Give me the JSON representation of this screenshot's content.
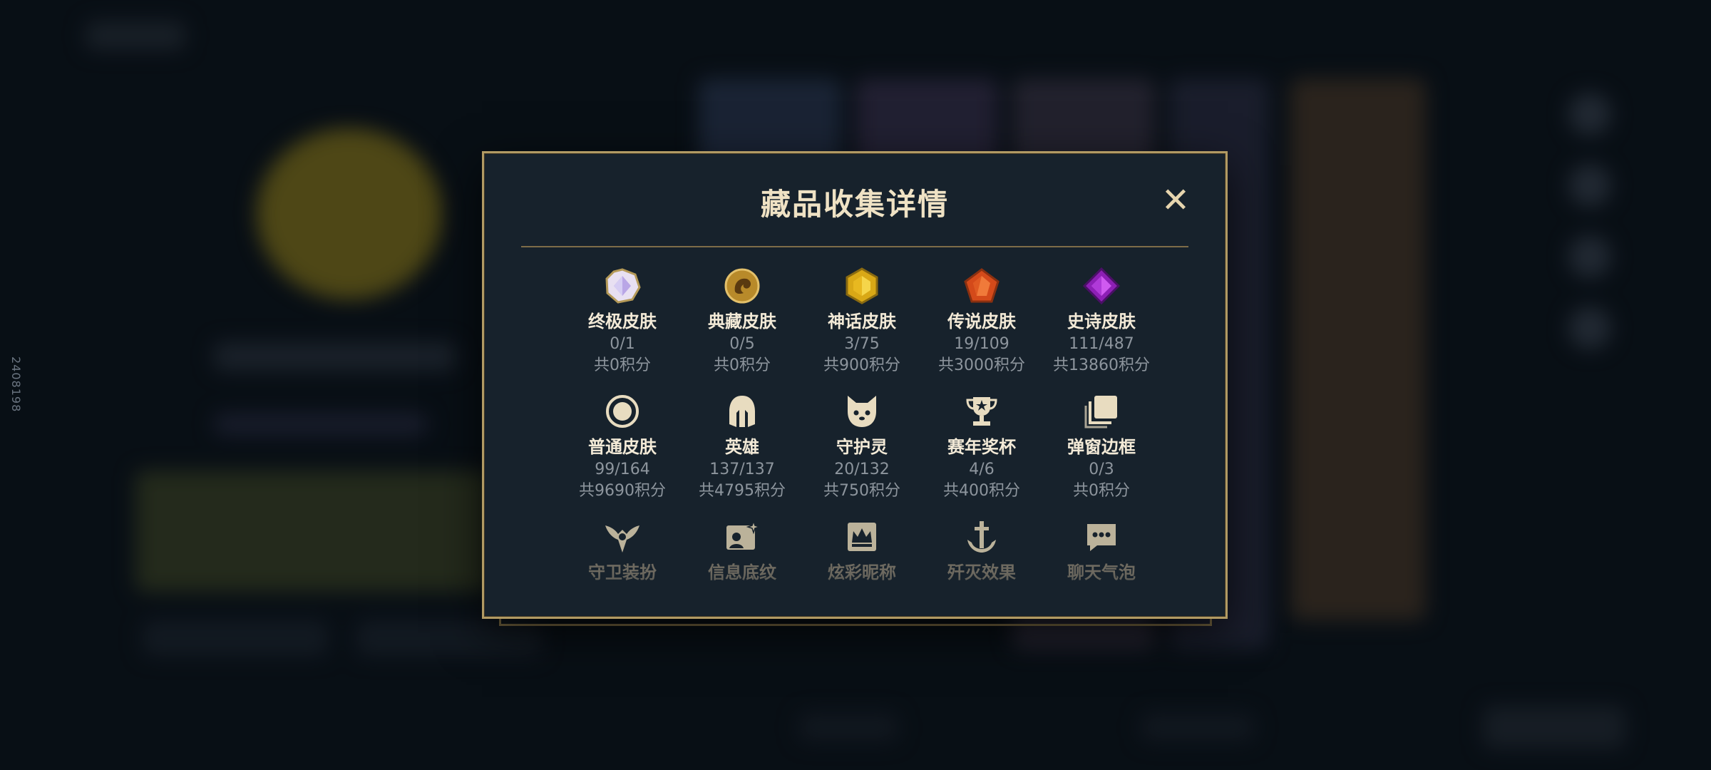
{
  "side_label": "2408198",
  "dialog": {
    "title": "藏品收集详情",
    "close_label": "✕"
  },
  "items": [
    {
      "name": "终极皮肤",
      "count": "0/1",
      "points": "共0积分",
      "icon": "ultimate-gem-icon"
    },
    {
      "name": "典藏皮肤",
      "count": "0/5",
      "points": "共0积分",
      "icon": "dragon-emblem-icon"
    },
    {
      "name": "神话皮肤",
      "count": "3/75",
      "points": "共900积分",
      "icon": "mythic-gem-icon"
    },
    {
      "name": "传说皮肤",
      "count": "19/109",
      "points": "共3000积分",
      "icon": "legendary-gem-icon"
    },
    {
      "name": "史诗皮肤",
      "count": "111/487",
      "points": "共13860积分",
      "icon": "epic-gem-icon"
    },
    {
      "name": "普通皮肤",
      "count": "99/164",
      "points": "共9690积分",
      "icon": "ring-icon"
    },
    {
      "name": "英雄",
      "count": "137/137",
      "points": "共4795积分",
      "icon": "helmet-icon"
    },
    {
      "name": "守护灵",
      "count": "20/132",
      "points": "共750积分",
      "icon": "guardian-icon"
    },
    {
      "name": "赛年奖杯",
      "count": "4/6",
      "points": "共400积分",
      "icon": "trophy-icon"
    },
    {
      "name": "弹窗边框",
      "count": "0/3",
      "points": "共0积分",
      "icon": "frame-icon"
    },
    {
      "name": "守卫装扮",
      "icon": "ward-icon"
    },
    {
      "name": "信息底纹",
      "icon": "banner-icon"
    },
    {
      "name": "炫彩昵称",
      "icon": "crown-card-icon"
    },
    {
      "name": "歼灭效果",
      "icon": "anchor-sword-icon"
    },
    {
      "name": "聊天气泡",
      "icon": "chat-bubble-icon"
    }
  ],
  "colors": {
    "accent_gold": "#b19a63",
    "panel": "#17222c",
    "title": "#efe2c4",
    "muted": "#8d959d"
  }
}
